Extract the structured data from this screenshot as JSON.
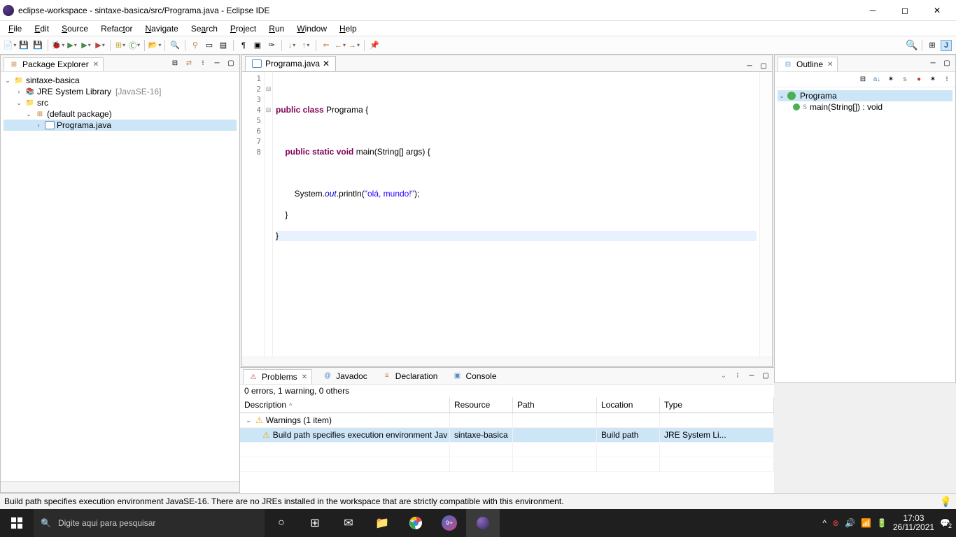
{
  "titlebar": {
    "title": "eclipse-workspace - sintaxe-basica/src/Programa.java - Eclipse IDE"
  },
  "menu": {
    "file": "File",
    "edit": "Edit",
    "source": "Source",
    "refactor": "Refactor",
    "navigate": "Navigate",
    "search": "Search",
    "project": "Project",
    "run": "Run",
    "window": "Window",
    "help": "Help"
  },
  "packageExplorer": {
    "title": "Package Explorer",
    "project": "sintaxe-basica",
    "jre": "JRE System Library",
    "jreVersion": "[JavaSE-16]",
    "src": "src",
    "pkg": "(default package)",
    "file": "Programa.java"
  },
  "editor": {
    "tab": "Programa.java",
    "lines": [
      "1",
      "2",
      "3",
      "4",
      "5",
      "6",
      "7",
      "8"
    ],
    "code": {
      "l2a": "public",
      "l2b": " class",
      "l2c": " Programa {",
      "l4a": "    public",
      "l4b": " static",
      "l4c": " void",
      "l4d": " main(String[] args) {",
      "l6a": "        System.",
      "l6b": "out",
      "l6c": ".println(",
      "l6d": "\"olá, mundo!\"",
      "l6e": ");",
      "l7": "    }",
      "l8": "}"
    }
  },
  "outline": {
    "title": "Outline",
    "class": "Programa",
    "method": "main(String[]) : void"
  },
  "bottom": {
    "tabs": {
      "problems": "Problems",
      "javadoc": "Javadoc",
      "declaration": "Declaration",
      "console": "Console"
    },
    "summary": "0 errors, 1 warning, 0 others",
    "cols": {
      "desc": "Description",
      "res": "Resource",
      "path": "Path",
      "loc": "Location",
      "type": "Type"
    },
    "warnGroup": "Warnings (1 item)",
    "warnDesc": "Build path specifies execution environment Jav",
    "warnRes": "sintaxe-basica",
    "warnLoc": "Build path",
    "warnType": "JRE System Li..."
  },
  "status": {
    "msg": "Build path specifies execution environment JavaSE-16. There are no JREs installed in the workspace that are strictly compatible with this environment."
  },
  "taskbar": {
    "search": "Digite aqui para pesquisar",
    "time": "17:03",
    "date": "26/11/2021",
    "notif": "2"
  }
}
